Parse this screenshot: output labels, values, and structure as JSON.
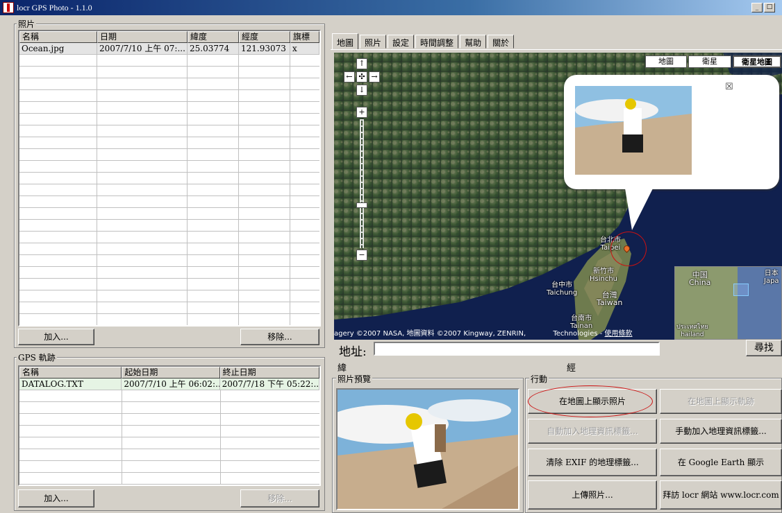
{
  "window": {
    "title": "locr GPS Photo - 1.1.0",
    "min": "_",
    "max": "□"
  },
  "photos": {
    "group_label": "照片",
    "columns": [
      "名稱",
      "日期",
      "緯度",
      "經度",
      "旗標"
    ],
    "rows": [
      [
        "Ocean.jpg",
        "2007/7/10 上午 07:...",
        "25.03774",
        "121.93073",
        "x"
      ]
    ],
    "add_label": "加入...",
    "remove_label": "移除..."
  },
  "gps": {
    "group_label": "GPS 軌跡",
    "columns": [
      "名稱",
      "起始日期",
      "終止日期"
    ],
    "rows": [
      [
        "DATALOG.TXT",
        "2007/7/10 上午 06:02:...",
        "2007/7/18 下午 05:22:..."
      ]
    ],
    "add_label": "加入...",
    "remove_label": "移除..."
  },
  "tabs": [
    "地圖",
    "照片",
    "設定",
    "時間調整",
    "幫助",
    "關於"
  ],
  "map": {
    "types": [
      "地圖",
      "衛星",
      "衛星地圖"
    ],
    "controls": {
      "up": "↑",
      "left": "←",
      "center": "✣",
      "right": "→",
      "down": "↓",
      "zoom_in": "+",
      "zoom_out": "−"
    },
    "close": "☒",
    "labels": {
      "taipei": "台北市",
      "taipei_en": "Taipei",
      "hsinchu": "新竹市",
      "hsinchu_en": "Hsinchu",
      "taichung": "台中市",
      "taichung_en": "Taichung",
      "taiwan": "台灣",
      "taiwan_en": "Taiwan",
      "tainan": "台南市",
      "tainan_en": "Tainan",
      "china": "中国",
      "china_en": "China",
      "japan": "日本",
      "japan_en": "Japa",
      "thai": "ประเทศไทย",
      "thai_en": "hailand"
    },
    "copyright": "agery ©2007 NASA, 地圖資料 ©2007 Kingway, ZENRIN, ",
    "copyright2": "Technologies - ",
    "terms": "使用條款"
  },
  "address": {
    "label": "地址:",
    "value": "",
    "search_label": "尋找",
    "lat_label": "緯",
    "lng_label": "經"
  },
  "preview": {
    "group_label": "照片預覽"
  },
  "actions": {
    "group_label": "行動",
    "show_photos": "在地圖上顯示照片",
    "show_track": "在地圖上顯示軌跡",
    "auto_geotag": "自動加入地理資訊標籤...",
    "manual_geotag": "手動加入地理資訊標籤...",
    "clear_exif": "清除 EXIF 的地理標籤...",
    "google_earth": "在 Google Earth 顯示",
    "upload": "上傳照片...",
    "visit": "拜訪 locr 網站 www.locr.com"
  },
  "colors": {
    "title_start": "#0a246a",
    "highlight_circle": "#cc1111",
    "water": "#10204e"
  }
}
